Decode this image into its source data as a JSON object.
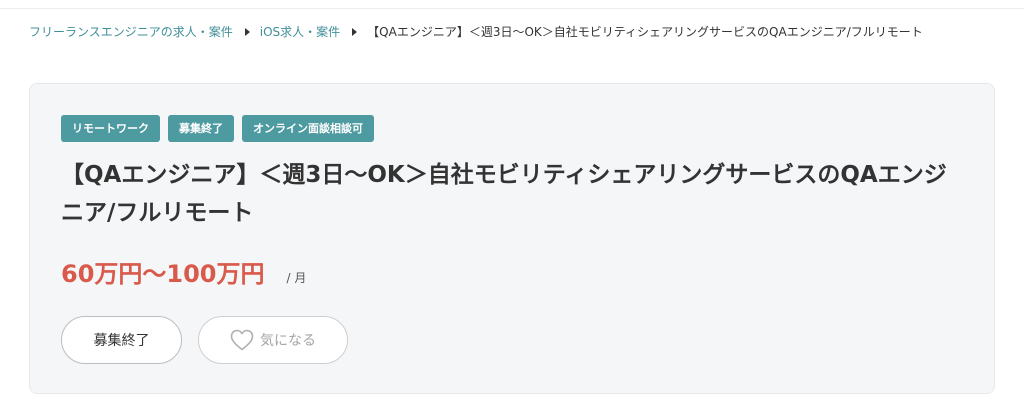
{
  "breadcrumb": {
    "items": [
      {
        "label": "フリーランスエンジニアの求人・案件"
      },
      {
        "label": "iOS求人・案件"
      },
      {
        "label": "【QAエンジニア】＜週3日〜OK＞自社モビリティシェアリングサービスのQAエンジニア/フルリモート"
      }
    ]
  },
  "job": {
    "tags": [
      "リモートワーク",
      "募集終了",
      "オンライン面談相談可"
    ],
    "title": "【QAエンジニア】＜週3日〜OK＞自社モビリティシェアリングサービスのQAエンジニア/フルリモート",
    "salary": "60万円〜100万円",
    "salary_unit": "/ 月",
    "closed_button_label": "募集終了",
    "favorite_button_label": "気になる"
  },
  "colors": {
    "tag_bg": "#4e9aa1",
    "link": "#3f8f98",
    "salary": "#d9594a",
    "card_bg": "#f4f6f8"
  },
  "icons": {
    "separator": "triangle-right-icon",
    "favorite": "heart-outline-icon"
  }
}
